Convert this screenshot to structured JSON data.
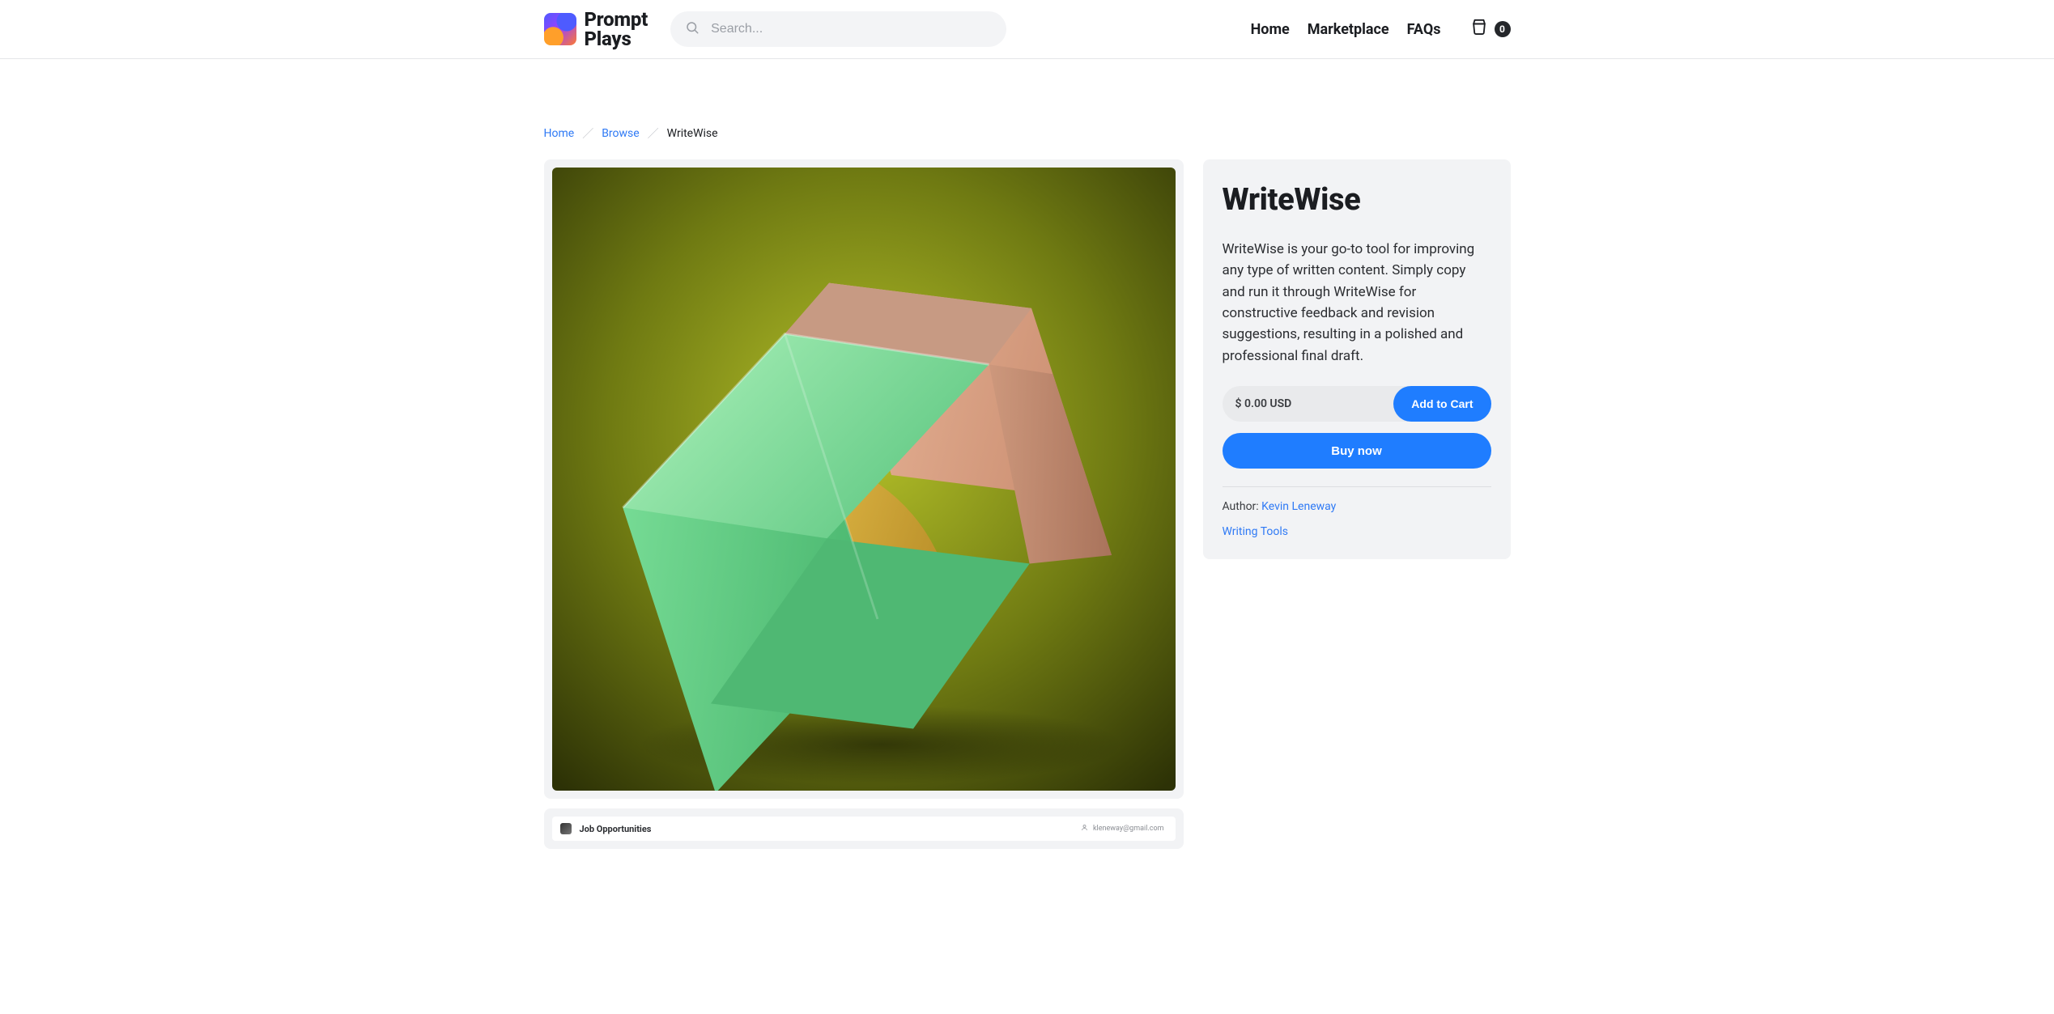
{
  "brand": {
    "line1": "Prompt",
    "line2": "Plays"
  },
  "search": {
    "placeholder": "Search..."
  },
  "nav": {
    "home": "Home",
    "marketplace": "Marketplace",
    "faqs": "FAQs"
  },
  "cart": {
    "count": "0"
  },
  "breadcrumb": {
    "home": "Home",
    "browse": "Browse",
    "current": "WriteWise"
  },
  "product": {
    "title": "WriteWise",
    "description": "WriteWise is your go-to tool for improving any type of written content. Simply copy and run it through WriteWise for constructive feedback and revision suggestions, resulting in a polished and professional final draft.",
    "price": "$ 0.00 USD",
    "add_to_cart": "Add to Cart",
    "buy_now": "Buy now",
    "author_prefix": "Author: ",
    "author_name": "Kevin Leneway",
    "category": "Writing Tools"
  },
  "thumb": {
    "title": "Job Opportunities",
    "email": "kleneway@gmail.com"
  }
}
